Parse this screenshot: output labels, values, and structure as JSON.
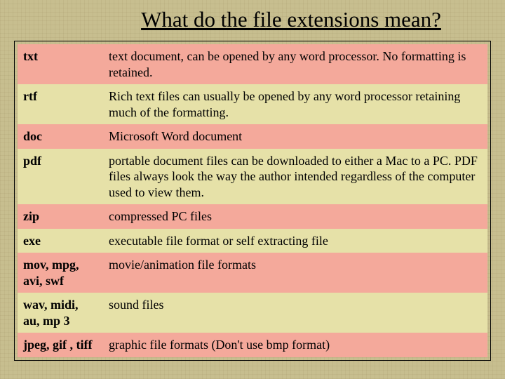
{
  "title": "What do the file extensions mean?",
  "rows": [
    {
      "ext": "txt",
      "desc": "text document, can be opened by any word processor. No formatting is retained."
    },
    {
      "ext": "rtf",
      "desc": "Rich text files can usually be opened by any word processor retaining much of the formatting."
    },
    {
      "ext": "doc",
      "desc": "Microsoft Word document"
    },
    {
      "ext": "pdf",
      "desc": "portable document files can be downloaded to either a Mac to a PC.  PDF files always look the way the author intended regardless of the computer used to view them."
    },
    {
      "ext": "zip",
      "desc": "compressed PC files"
    },
    {
      "ext": "exe",
      "desc": "executable file format or self extracting file"
    },
    {
      "ext": "mov, mpg, avi, swf",
      "desc": "movie/animation file formats"
    },
    {
      "ext": "wav, midi, au, mp 3",
      "desc": "sound files"
    },
    {
      "ext": "jpeg, gif , tiff",
      "desc": "graphic file formats (Don't use bmp format)"
    }
  ]
}
